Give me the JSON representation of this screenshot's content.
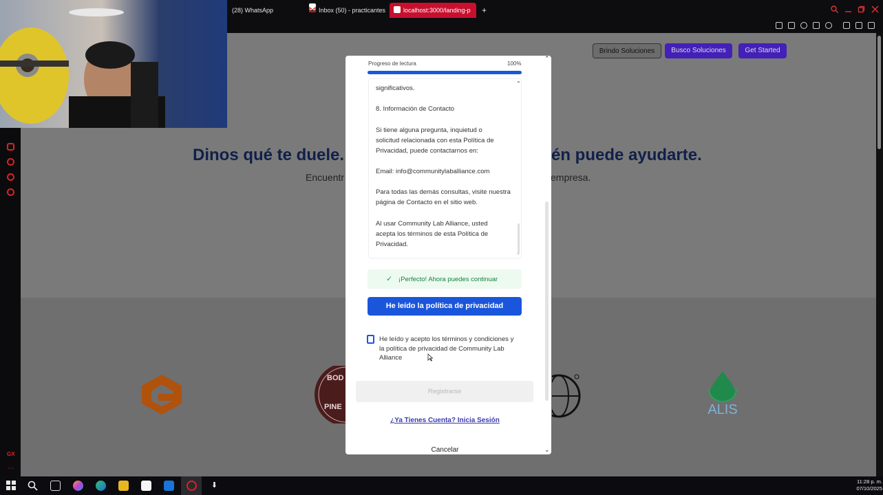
{
  "browser": {
    "tabs": [
      {
        "label": "(28) WhatsApp",
        "favicon": "whatsapp-icon"
      },
      {
        "label": "Inbox (50) - practicantes",
        "favicon": "gmail-icon"
      },
      {
        "label": "localhost:3000/landing-p",
        "favicon": "localhost-icon"
      }
    ],
    "accent": "#c8102e"
  },
  "page": {
    "nav": {
      "brindo": "Brindo Soluciones",
      "busco": "Busco Soluciones",
      "started": "Get Started"
    },
    "hero_left": "Dinos qué te duele.",
    "hero_right": "én puede ayudarte.",
    "sub_left": "Encuentr",
    "sub_right": "empresa.",
    "logo_text": "ALIS",
    "logo_bod": "BOD",
    "logo_pine": "PINE"
  },
  "modal": {
    "progress_label": "Progreso de lectura",
    "progress_pct_text": "100%",
    "progress_value": 100,
    "policy": {
      "p1": "significativos.",
      "p2": "8. Información de Contacto",
      "p3": "Si tiene alguna pregunta, inquietud o solicitud relacionada con esta Política de Privacidad, puede contactarnos en:",
      "p4": "Email: info@communitylaballiance.com",
      "p5": "Para todas las demás consultas, visite nuestra página de Contacto en el sitio web.",
      "p6": "Al usar Community Lab Alliance, usted acepta los términos de esta Política de Privacidad."
    },
    "success_text": "¡Perfecto! Ahora puedes continuar",
    "read_button": "He leído la política de privacidad",
    "checkbox_label": "He leído y acepto los términos y condiciones y la política de privacidad de Community Lab Alliance",
    "register_button": "Registrarse",
    "login_link": "¿Ya Tienes Cuenta? Inicia Sesión",
    "cancel": "Cancelar"
  },
  "taskbar": {
    "time": "11:28 p. m.",
    "date": "07/10/2025"
  }
}
